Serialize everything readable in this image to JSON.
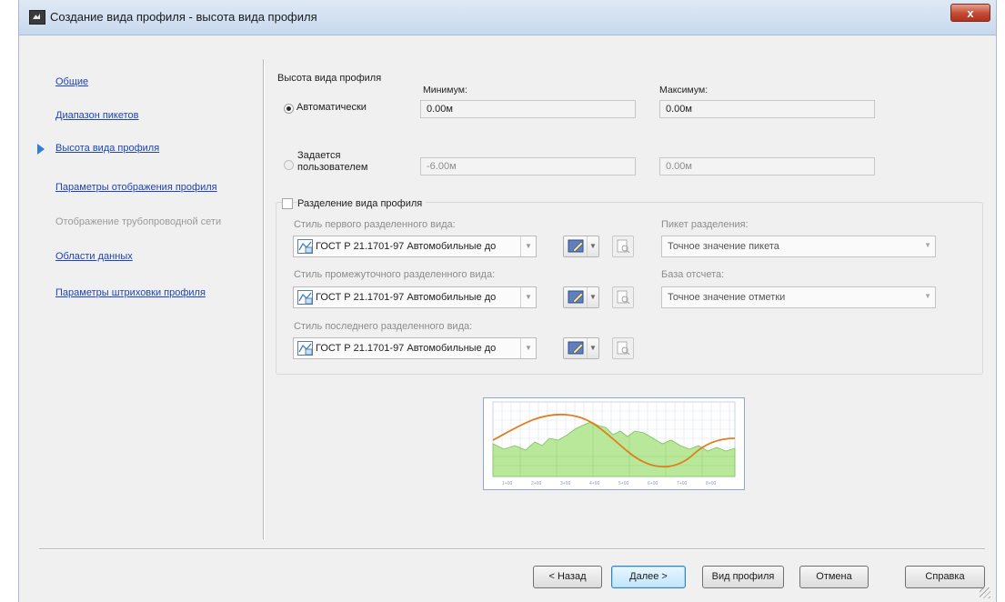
{
  "window": {
    "title": "Создание вида профиля - высота вида профиля",
    "close_label": "x"
  },
  "nav": {
    "items": [
      {
        "label": "Общие",
        "state": "link"
      },
      {
        "label": "Диапазон пикетов",
        "state": "link"
      },
      {
        "label": "Высота вида профиля",
        "state": "current"
      },
      {
        "label": "Параметры отображения профиля",
        "state": "link"
      },
      {
        "label": "Отображение трубопроводной сети",
        "state": "disabled"
      },
      {
        "label": "Области данных",
        "state": "link"
      },
      {
        "label": "Параметры штриховки профиля",
        "state": "link"
      }
    ]
  },
  "height": {
    "section_label": "Высота вида профиля",
    "min_label": "Минимум:",
    "max_label": "Максимум:",
    "auto_label": "Автоматически",
    "user_label_line1": "Задается",
    "user_label_line2": "пользователем",
    "auto_min": "0.00м",
    "auto_max": "0.00м",
    "user_min": "-6.00м",
    "user_max": "0.00м",
    "selected": "auto"
  },
  "split": {
    "checkbox_label": "Разделение вида профиля",
    "checked": false,
    "first_style_label": "Стиль первого разделенного вида:",
    "mid_style_label": "Стиль промежуточного разделенного вида:",
    "last_style_label": "Стиль последнего разделенного вида:",
    "style_value": "ГОСТ Р 21.1701-97 Автомобильные до",
    "station_label": "Пикет разделения:",
    "station_value": "Точное значение пикета",
    "datum_label": "База отсчета:",
    "datum_value": "Точное значение отметки"
  },
  "preview": {
    "tick_labels": [
      "1+00",
      "2+00",
      "3+00",
      "4+00",
      "5+00",
      "6+00",
      "7+00",
      "8+00"
    ],
    "ground_color": "#b9e89a",
    "line_color": "#e07d1e"
  },
  "buttons": {
    "back": "< Назад",
    "next": "Далее >",
    "create": "Вид профиля",
    "cancel": "Отмена",
    "help": "Справка"
  }
}
